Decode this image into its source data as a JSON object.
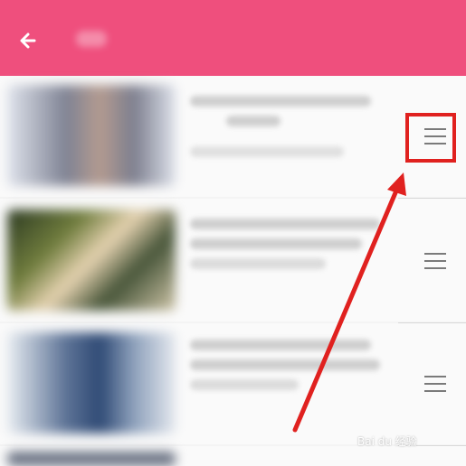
{
  "header": {
    "back_icon": "arrow-left-icon",
    "background": "#ef4f7d"
  },
  "list": {
    "items": [
      {
        "drag_icon": "drag-handle-icon"
      },
      {
        "drag_icon": "drag-handle-icon"
      },
      {
        "drag_icon": "drag-handle-icon"
      }
    ]
  },
  "annotation": {
    "highlight_color": "#e0211f",
    "arrow_color": "#e0211f"
  },
  "watermark": {
    "text": "Bai du 经验"
  }
}
